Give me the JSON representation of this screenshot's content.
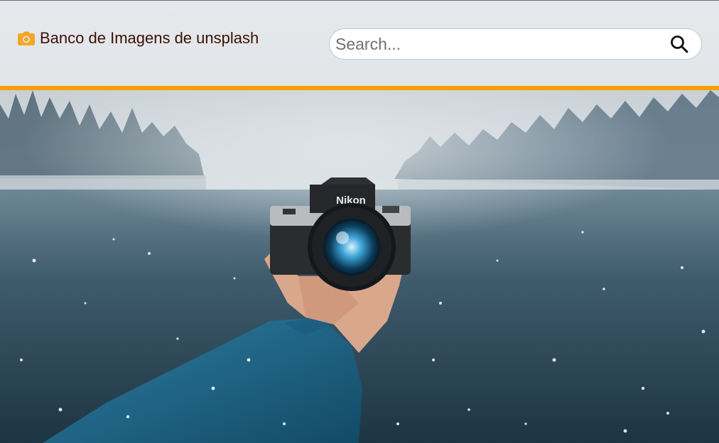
{
  "header": {
    "brand_icon": "camera-icon",
    "brand_text": "Banco de Imagens de unsplash",
    "search_placeholder": "Search...",
    "search_icon": "search-icon"
  },
  "colors": {
    "accent": "#f5a000",
    "brand_icon": "#f5a623",
    "brand_text": "#3b1008"
  },
  "hero": {
    "camera_brand": "Nikon"
  }
}
